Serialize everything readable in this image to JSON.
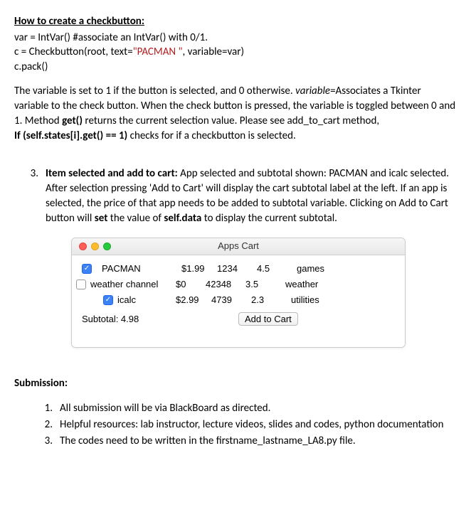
{
  "heading1": "How to create a checkbutton:",
  "code": {
    "line1a": "var = IntVar() #associate an IntVar() with 0/1.",
    "line2a": " c = Checkbutton(root, text=",
    "line2b": "\"PACMAN \"",
    "line2c": ", variable=var)",
    "line3": "c.pack()"
  },
  "para1_a": "The variable is set to 1 if the button is selected, and 0 otherwise. ",
  "para1_var": "variable",
  "para1_b": "=Associates a Tkinter variable to the check button. When the check button is pressed, the variable is toggled between 0 and 1. Method ",
  "para1_get": "get()",
  "para1_c": " returns the current selection value. Please see add_to_cart method,",
  "para1_if": "If (self.states[i].get() == 1) ",
  "para1_d": "checks for if a checkbutton is selected.",
  "item3_num": "3.",
  "item3_title": "Item selected and add to cart: ",
  "item3_body_a": "App selected and subtotal shown: PACMAN and icalc selected. After selection pressing 'Add to Cart' will display the cart subtotal label at the left. If an app is selected, the price of that app needs to be added to subtotal variable. Clicking on Add to Cart button will ",
  "item3_set": "set",
  "item3_body_b": " the value of ",
  "item3_selfdata": "self.data",
  "item3_body_c": " to display the current subtotal.",
  "window": {
    "title": "Apps Cart",
    "rows": [
      {
        "checked": true,
        "name": "PACMAN",
        "price": "$1.99",
        "id": "1234",
        "rating": "4.5",
        "cat": "games"
      },
      {
        "checked": false,
        "name": "weather channel",
        "price": "$0",
        "id": "42348",
        "rating": "3.5",
        "cat": "weather"
      },
      {
        "checked": true,
        "name": "icalc",
        "price": "$2.99",
        "id": "4739",
        "rating": "2.3",
        "cat": "utilities"
      }
    ],
    "subtotal": "Subtotal: 4.98",
    "add_btn": "Add to Cart"
  },
  "submission_title": "Submission:",
  "sub_items": {
    "n1": "1.",
    "t1": "All submission will be via BlackBoard as directed.",
    "n2": "2.",
    "t2": "Helpful resources: lab instructor, lecture videos, slides and codes, python documentation",
    "n3": "3.",
    "t3": "The codes need to be written in the firstname_lastname_LA8.py file."
  },
  "checkmark": "✓"
}
